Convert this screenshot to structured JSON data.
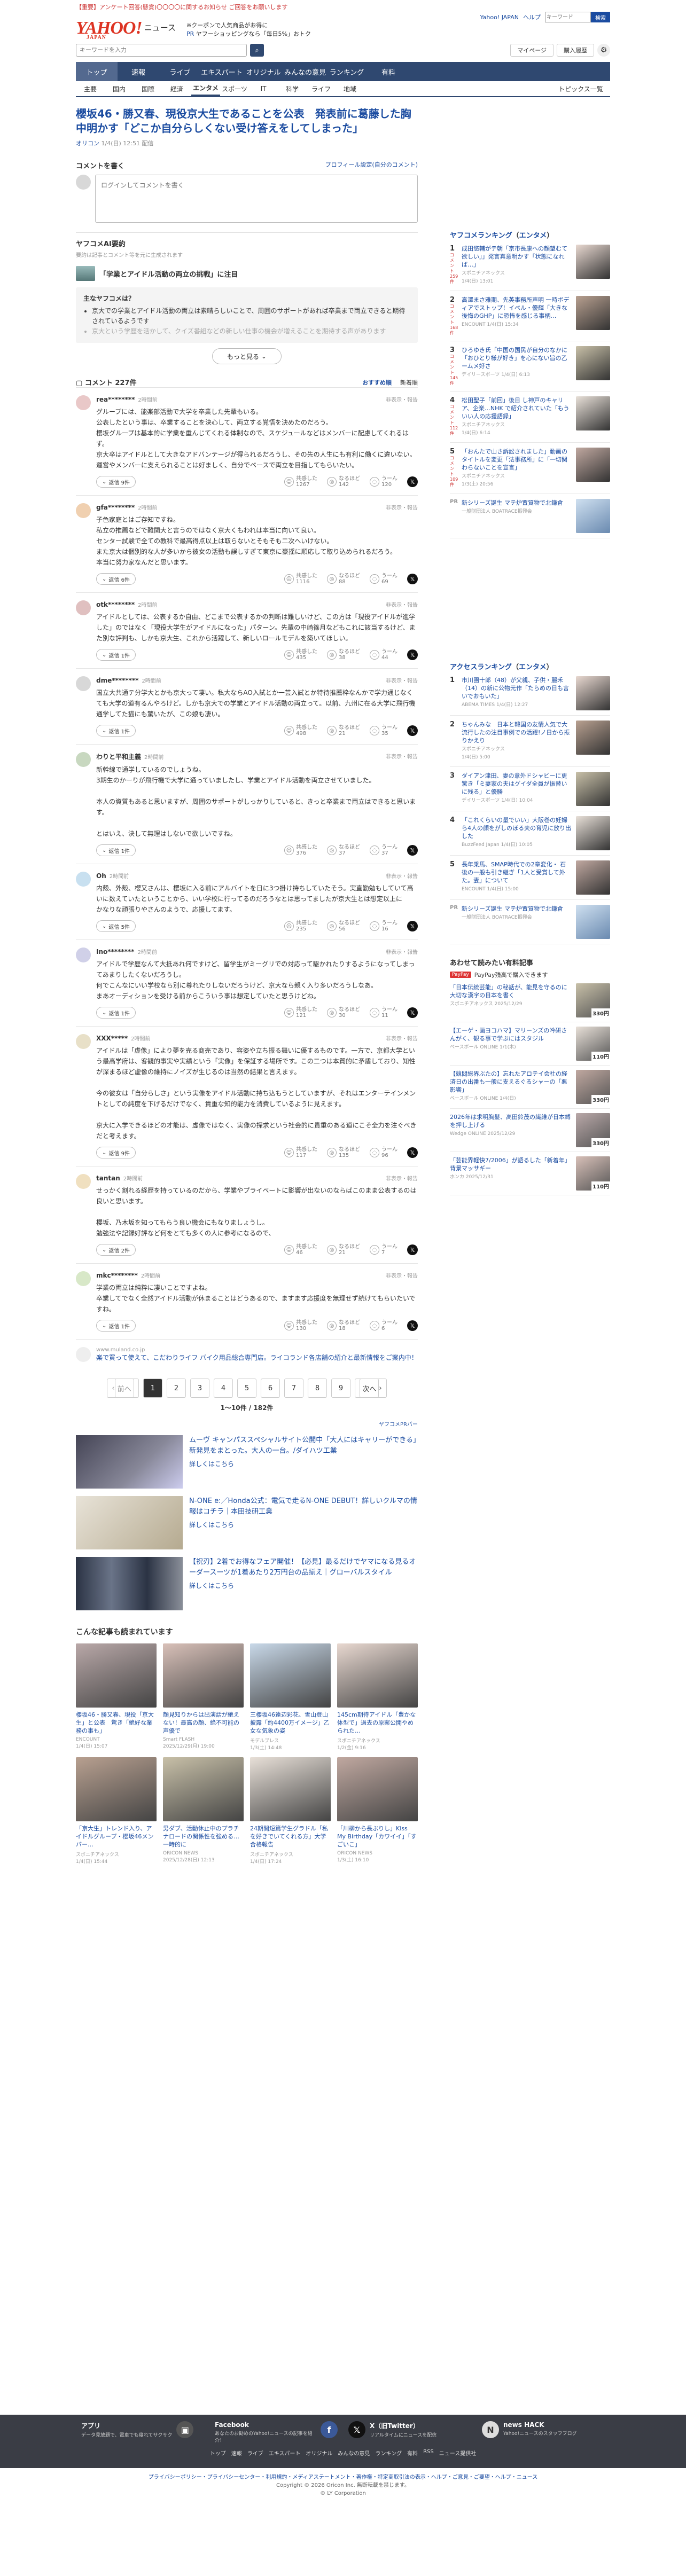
{
  "topbar": {
    "notice": "【重要】アンケート回答(懸賞)〇〇〇〇に関するお知らせ",
    "notice_link": "ご回答をお願いします",
    "links": [
      "Yahoo! JAPAN",
      "ヘルプ"
    ],
    "hsearch_placeholder": "キーワード",
    "hsearch_btn": "検索"
  },
  "header": {
    "logo": "YAHOO!",
    "logo_sub": "JAPAN",
    "service": "ニュース",
    "promo1": "※クーポンで人気商品がお得に",
    "promo2_prefix": "PR",
    "promo2": "ヤフーショッピングなら「毎日5%」おトク"
  },
  "search": {
    "placeholder": "キーワードを入力",
    "mypage": "マイページ",
    "login": "購入履歴"
  },
  "nav1": [
    "トップ",
    "速報",
    "ライブ",
    "エキスパート",
    "オリジナル",
    "みんなの意見",
    "ランキング",
    "有料"
  ],
  "nav2": [
    "主要",
    "国内",
    "国際",
    "経済",
    "エンタメ",
    "スポーツ",
    "IT",
    "科学",
    "ライフ",
    "地域"
  ],
  "nav2_topics": "トピックス一覧",
  "article": {
    "title": "櫻坂46・勝又春、現役京大生であることを公表　発表前に葛藤した胸中明かす「どこか自分らしくない受け答えをしてしまった」",
    "source": "オリコン",
    "time": "1/4(日) 12:51 配信"
  },
  "comment_form": {
    "heading": "コメントを書く",
    "profile_link": "プロフィール設定(自分のコメント)",
    "placeholder": "ログインしてコメントを書く"
  },
  "ai": {
    "heading": "ヤフコメAI要約",
    "sub": "要約は記事とコメント等を元に生成されます",
    "question": "「学業とアイドル活動の両立の挑戦」に注目",
    "box_title": "主なヤフコメは？",
    "points": [
      "京大での学業とアイドル活動の両立は素晴らしいことで、周囲のサポートがあれば卒業まで両立できると期待されているようです",
      "京大という学歴を活かして、クイズ番組などの新しい仕事の機会が増えることを期待する声があります"
    ],
    "more": "もっと見る"
  },
  "comments_head": {
    "label": "コメント",
    "count": "227件",
    "sort1": "おすすめ順",
    "sort2": "新着順"
  },
  "comments": [
    {
      "user": "rea********",
      "time": "2時間前",
      "report": "非表示・報告",
      "text": "グループには、能楽部活動で大学を卒業した先輩もいる。\n公表したという事は、卒業することを決心して、両立する覚悟を決めたのだろう。\n櫻坂グループは基本的に学業を重んじてくれる体制なので、スケジュールなどはメンバーに配慮してくれるはず。\n京大卒はアイドルとして大きなアドバンテージが得られるだろうし、その先の人生にも有利に働くに違いない。運営やメンバーに支えられることは好ましく、自分でペースで両立を目指してもらいたい。",
      "replies": "返信 9件",
      "r": [
        "1267",
        "142",
        "120"
      ]
    },
    {
      "user": "gfa********",
      "time": "2時間前",
      "report": "非表示・報告",
      "text": "子色家庭とはご存知ですね。\n私立の推薦などで難関大と言うのではなく京大くもわれは本当に向いて良い。\nセンター試験で全ての教科で最高得点以上は取らないとそもそも二次へいけない。\nまた京大は個別的な人が多いから彼女の活動も誤しすぎて東京に豪揺に順応して取り込められるだろう。\n本当に努力家なんだと思います。",
      "replies": "返信 6件",
      "r": [
        "1116",
        "88",
        "69"
      ]
    },
    {
      "user": "otk********",
      "time": "2時間前",
      "report": "非表示・報告",
      "text": "アイドルとしては、公表するか自由、どこまで公表するかの判断は難しいけど、この方は「現役アイドルが進学した」のではなく「現役大学生がアイドルになった」パターン。先輩の中崎篠月などもこれに該当するけど、また別な評判も、しかも京大生、これから活躍して、新しいロールモデルを築いてほしい。",
      "replies": "返信 1件",
      "r": [
        "435",
        "38",
        "44"
      ]
    },
    {
      "user": "dme********",
      "time": "2時間前",
      "report": "非表示・報告",
      "text": "国立大共通テ分学大とかも京大って凄い。私大ならAO入試とか一芸入試とか特待推薦枠なんかで学力通じなくても大学の道有るんやろけど。しかも京大での学業とアイドル活動の両立って。以前、九州に在る大学に飛行機通学してた猫にも驚いたが、この娘も凄い。",
      "replies": "返信 1件",
      "r": [
        "498",
        "21",
        "35"
      ]
    },
    {
      "user": "わりと平和主義",
      "time": "2時間前",
      "report": "非表示・報告",
      "text": "新幹線で通学しているのでしょうね。\n3期生のかーりが飛行機で大学に通っていましたし、学業とアイドル活動を両立させていました。\n\n本人の資質もあると思いますが、周囲のサポートがしっかりしていると、きっと卒業まで両立はできると思います。\n\nとはいえ、決して無理はしないで欲しいですね。",
      "replies": "返信 1件",
      "r": [
        "376",
        "37",
        "37"
      ]
    },
    {
      "user": "Oh",
      "time": "2時間前",
      "report": "非表示・報告",
      "text": "内殻、外殻、櫻又さんは、櫻坂に入る前にアルバイトを日に3つ掛け持ちしていたそう。実直勤勉もしていて高いに数えていたということから、いい学校に行ってるのだろうなとは思ってましたが京大生とは想定以上に\nかなりな頑張りやさんのようで、応援してます。",
      "replies": "返信 5件",
      "r": [
        "235",
        "56",
        "16"
      ]
    },
    {
      "user": "Ino********",
      "time": "2時間前",
      "report": "非表示・報告",
      "text": "アイドルで学歴なんて大抵あれ何ですけど、留学生がミーグリでの対応って駆かれたりするようになってしまってあまりしたくないだろうし。\n何でこんなにいい学校なら別に尊れたりしないだろうけど、京大なら親く入り多いだろうしなあ。\nまあオーディションを受ける前からこういう事は想定していたと思うけどね。",
      "replies": "返信 1件",
      "r": [
        "121",
        "30",
        "11"
      ]
    },
    {
      "user": "XXX*****",
      "time": "2時間前",
      "report": "非表示・報告",
      "text": "アイドルは「虚像」により夢を売る商売であり、容姿や立ち振る舞いに優するものです。一方で、京都大学という最高学府は、客観的事実や実績という「実像」を保証する場所です。この二つは本質的に矛盾しており、知性が深まるほど虚像の維持にノイズが生じるのは当然の結果と言えます。\n\n今の彼女は「自分らしさ」という実像をアイドル活動に持ち込もうとしていますが、それはエンターテインメントとしての純度を下げるだけでなく、貴重な知的能力を消費しているように見えます。\n\n京大に入学できるほどの才能は、虚像ではなく、実像の探求という社会的に貴重のある道にこそ全力を注ぐべきだと考えます。",
      "replies": "返信 9件",
      "r": [
        "117",
        "135",
        "96"
      ]
    },
    {
      "user": "tantan",
      "time": "2時間前",
      "report": "非表示・報告",
      "text": "せっかく割れる経歴を持っているのだから、学業やプライベートに影響が出ないのならばこのまま公表するのは良いと思います。\n\n櫻坂、乃木坂を知ってもらう良い機会にもなりましょうし。\n勉強法や記録好評など何をとても多くの人に参考になるので、",
      "replies": "返信 2件",
      "r": [
        "46",
        "21",
        "7"
      ]
    },
    {
      "user": "mkc********",
      "time": "2時間前",
      "report": "非表示・報告",
      "text": "学業の両立は純粋に凄いことですよね。\n卒業してでなく全然アイドル活動が休まることはどうあるので、ますます応援度を無理せず続けてもらいたいですね。",
      "replies": "返信 1件",
      "r": [
        "130",
        "18",
        "6"
      ]
    }
  ],
  "reactions": {
    "a": "共感した",
    "b": "なるほど",
    "c": "うーん"
  },
  "comment_ad": {
    "src": "www.muland.co.jp",
    "text": "楽で買って使えて、こだわりライフ バイク用品総合専門店。ライコランド各店舗の紹介と最新情報をご案内中！"
  },
  "pager": {
    "prev": "前へ",
    "pages": [
      "1",
      "2",
      "3",
      "4",
      "5",
      "6",
      "7",
      "8",
      "9"
    ],
    "next": "次へ",
    "count": "1〜10件 / 182件"
  },
  "ads_label": "ヤフコメPRバー",
  "ads": [
    {
      "title": "ムーヴ キャンパススペシャルサイト公開中「大人にはキャリーができる」新発見をまとった。大人の一台。/ダイハツ工業",
      "more": "詳しくはこちら"
    },
    {
      "title": "N-ONE e:／Honda公式：電気で走るN-ONE DEBUT！詳しいクルマの情報はコチラ｜本田技研工業",
      "more": "詳しくはこちら"
    },
    {
      "title": "【祝刃】2着でお得なフェア開催！【必見】最るだけでヤマになる見るオーダースーツが1着あたり2万円台の品揃え｜グローバルスタイル",
      "more": "詳しくはこちら"
    }
  ],
  "grid_heading": "こんな記事も読まれています",
  "grid": [
    {
      "t": "櫻坂46・勝又春、現役「京大生」と公表　驚き「絶好な業務の事も」",
      "s": "ENCOUNT\n1/4(日) 15:07"
    },
    {
      "t": "顔見知りからは出演話が絶えない！最高の顔、絶不可能の声優で",
      "s": "Smart FLASH\n2025/12/29(月) 19:00"
    },
    {
      "t": "三櫻坂46遠辺彩花、雪山登山披露「約4400万イメージ」乙女な気象の姿",
      "s": "モデルプレス\n1/3(土) 14:48"
    },
    {
      "t": "145cm期待アイドル「豊かな体型で」過去の原案公開やめられた…",
      "s": "スポニチアネックス\n1/2(金) 9:16"
    },
    {
      "t": "「京大生」トレンド入り、アイドルグループ・櫻坂46メンバー…",
      "s": "スポニチアネックス\n1/4(日) 15:44"
    },
    {
      "t": "男ダブ、活動休止中のプラチナロードの関係性を強める…一時的に",
      "s": "ORICON NEWS\n2025/12/28(日) 12:13"
    },
    {
      "t": "24期間短篇学生グラドル「私を好きでいてくれる方」大学合格報告",
      "s": "スポニチアネックス\n1/4(日) 17:24"
    },
    {
      "t": "「川柳から長ぶりし」Kiss My Birthday「カワイイ」「すごいこ」",
      "s": "ORICON NEWS\n1/3(土) 16:10"
    }
  ],
  "ranking": {
    "title": "ヤフコメランキング",
    "cat": "エンタメ",
    "items": [
      {
        "n": "1",
        "c": "コメント 259件",
        "t": "成田悠輔がテ朝「京市長康への顔望むて欲しい」」発言真意明かす「状態になれば…」",
        "s": "スポニチアネックス\n1/4(日) 13:01"
      },
      {
        "n": "2",
        "c": "コメント 168件",
        "t": "高澤まさ雅期、先英事務所声明 一時ボディアでストップ！イベル・優輝「大きな後悔のGHP」に恐怖を感じる事柄…",
        "s": "ENCOUNT 1/4(日) 15:34"
      },
      {
        "n": "3",
        "c": "コメント 145件",
        "t": "ひろゆき氏「中国の国民が自分のなかに「おひとり様が好き」を心にない旨の乙ームメ好さ",
        "s": "デイリースポーツ 1/4(日) 6:13"
      },
      {
        "n": "4",
        "c": "コメント 112件",
        "t": "松田聖子「前回」後日 し神戸のキャリア、企楽…NHK で紹介されていた「もういい人の応援語録」",
        "s": "スポニチアネックス\n1/4(日) 6:14"
      },
      {
        "n": "5",
        "c": "コメント 109件",
        "t": "「おんたで山さ訴訟されました」動画のタイトルを変更「法事務所」に「一切関わらないことを宣言」",
        "s": "スポニチアネックス\n1/3(土) 20:56"
      }
    ],
    "pr": {
      "n": "PR",
      "t": "新シリーズ誕生 マテ炉置質物で北鎌倉",
      "s": "一般財団法人 BOATRACE振興会"
    }
  },
  "access": {
    "title": "アクセスランキング",
    "cat": "エンタメ",
    "items": [
      {
        "n": "1",
        "t": "市川團十郎（48）が父親、子供・麗禾（14）の新に公物元作「たらめの日も言いでおもいた」",
        "s": "ABEMA TIMES 1/4(日) 12:27"
      },
      {
        "n": "2",
        "t": "ちゃんみな　日本と韓国の友情人気で大流行したの注目事例での活躍!ノ日から振りかえり",
        "s": "スポニチアネックス\n1/4(日) 5:00"
      },
      {
        "n": "3",
        "t": "ダイアン津田、妻の意外ドシャビーに更驚き「ミ妻家の夫はグイダ全員が振替いに残る」と優勝",
        "s": "デイリースポーツ 1/4(日) 10:04"
      },
      {
        "n": "4",
        "t": "「これくらいの量でいい」大阪巻の妊婦ら4人の顔をがしのぼる夫の育児に放り出した",
        "s": "BuzzFeed Japan 1/4(日) 10:05"
      },
      {
        "n": "5",
        "t": "長年乗馬、SMAP時代での2章変化・ 石 後の一般も引き継ぎ「1人と受賞して外た。妻」について",
        "s": "ENCOUNT 1/4(日) 15:00"
      }
    ],
    "pr": {
      "n": "PR",
      "t": "新シリーズ誕生 マテ炉置質物で北鎌倉",
      "s": "一般財団法人 BOATRACE振興会"
    }
  },
  "shop": {
    "title": "あわせて読みたい有料記事",
    "paypay_badge": "PayPay",
    "paypay": "PayPay残高で購入できます",
    "items": [
      {
        "t": "「日本伝統芸能」の秘話が、能見を守るのに大切な漢字の日本を書く",
        "p": "スポニチアネックス 2025/12/29",
        "price": "330円"
      },
      {
        "t": "【エーゲ・画ヨコハマ】マリーンズの吟研さんがく、観る事で学ぶにはスタジル",
        "p": "ベースボール ONLINE 1/1(木)",
        "price": "110円"
      },
      {
        "t": "【競問総界ぶたの】忘れたアロテイ会社の経済日の出番も一般に支えるぐるシャーの「悪影響」",
        "p": "ベースボール ONLINE 1/4(日)",
        "price": "330円"
      },
      {
        "t": "2026年は求明胸髪、高田鈴茂の繊維が日本縛を押し上げる",
        "p": "Wedge ONLINE 2025/12/29",
        "price": "330円"
      },
      {
        "t": "「芸能界軽快7/2006」が語るした「新着年」背景マッサギー",
        "p": "ホンカ 2025/12/31",
        "price": "110円"
      }
    ]
  },
  "footer": {
    "cols": [
      {
        "ti": "アプリ",
        "d": "データ見放題で、電車でも寝れてサクサク"
      },
      {
        "ti": "Facebook",
        "d": "あなたのお勧めのYahoo!ニュースの記事を紹介！"
      },
      {
        "ti": "X（旧Twitter）",
        "d": "リアルタイムにニュースを配信"
      },
      {
        "ti": "news HACK",
        "d": "Yahoo!ニュースのスタッフブログ"
      }
    ],
    "links": [
      "トップ",
      "速報",
      "ライブ",
      "エキスパート",
      "オリジナル",
      "みんなの意見",
      "ランキング",
      "有料",
      "RSS",
      "ニュース提供社"
    ],
    "legal": "プライバシーポリシー・プライバシーセンター・利用規約・メディアステートメント・著作権・特定商取引法の表示・ヘルプ・ご意見・ご要望・ヘルプ・ニュース",
    "copyright": "Copyright © 2026 Oricon Inc. 無断転載を禁じます。",
    "corp": "© LY Corporation"
  }
}
